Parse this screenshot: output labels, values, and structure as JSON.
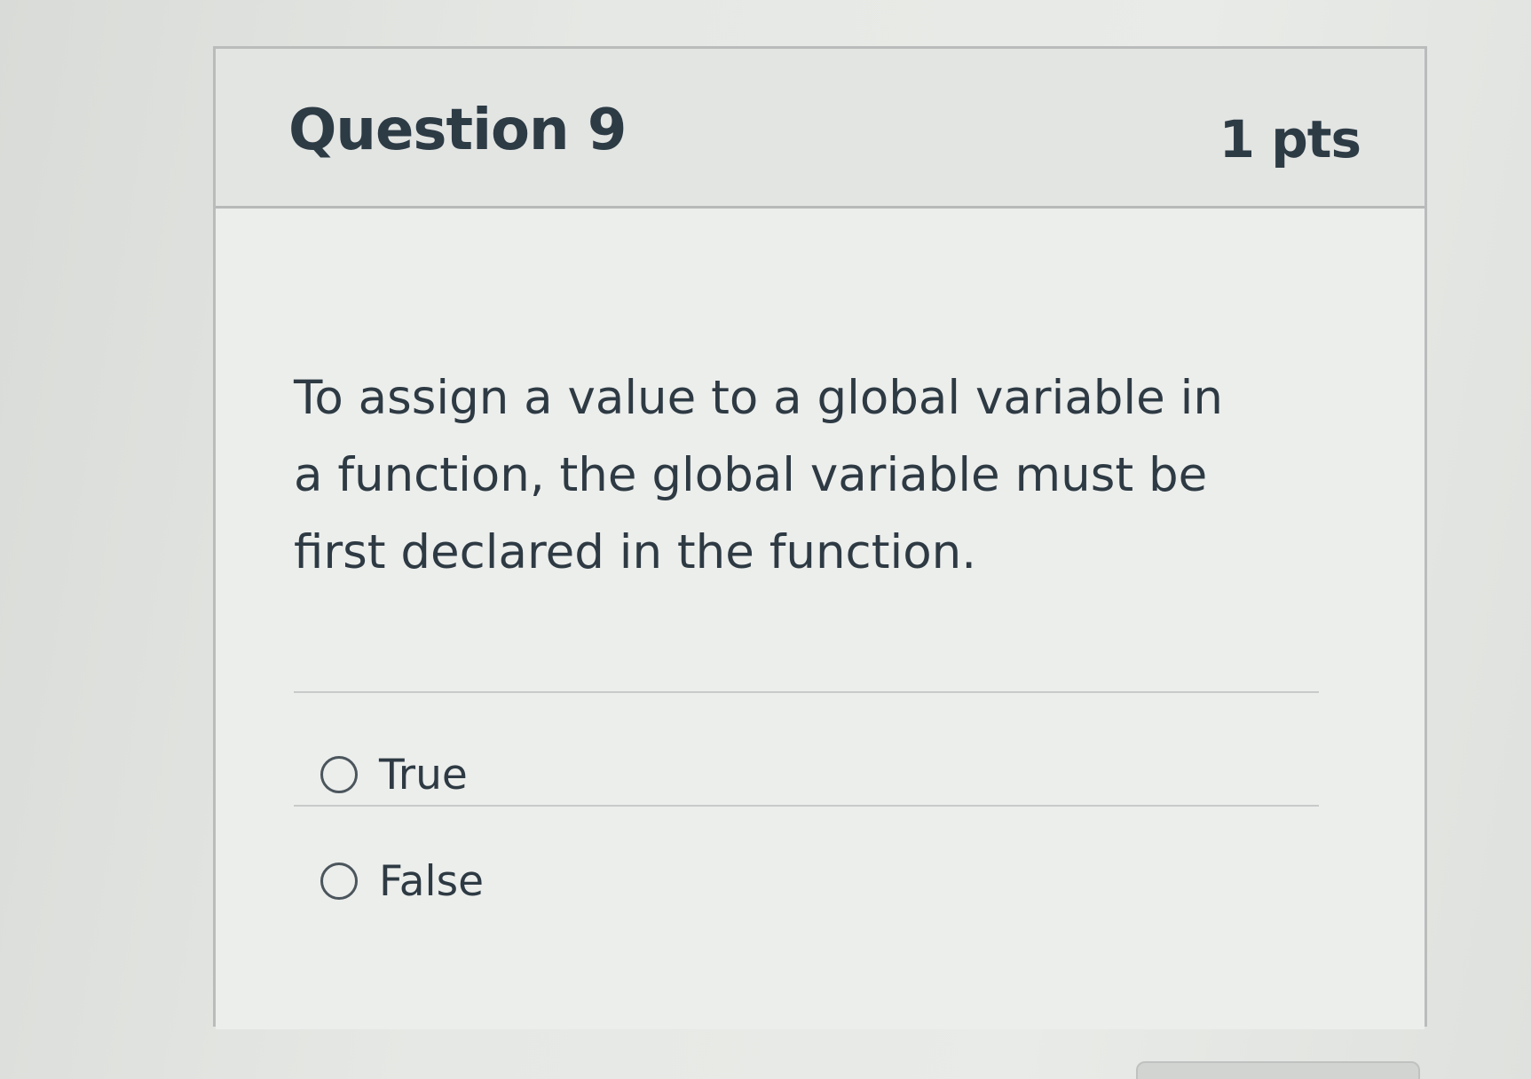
{
  "question": {
    "title": "Question 9",
    "points": "1 pts",
    "text": "To assign a value to a global variable in a function, the global variable must be first declared in the function.",
    "answers": [
      {
        "label": "True",
        "selected": false
      },
      {
        "label": "False",
        "selected": false
      }
    ]
  },
  "colors": {
    "text": "#2d3b45",
    "border": "#b9bcbb",
    "header_bg": "#e3e5e3",
    "radio_border": "#4b555c"
  }
}
